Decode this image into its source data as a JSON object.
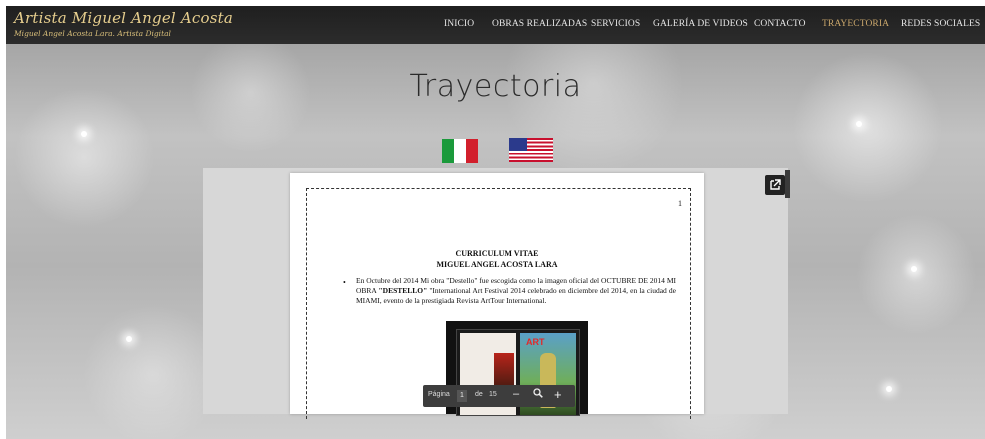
{
  "brand": {
    "title": "Artista Miguel Angel Acosta",
    "subtitle": "Miguel Angel Acosta Lara. Artista Digital"
  },
  "nav": {
    "items": [
      {
        "label": "INICIO"
      },
      {
        "label": "OBRAS REALIZADAS"
      },
      {
        "label": "SERVICIOS"
      },
      {
        "label": "GALERÍA DE VIDEOS"
      },
      {
        "label": "CONTACTO"
      },
      {
        "label": "TRAYECTORIA",
        "active": true
      },
      {
        "label": "REDES SOCIALES"
      }
    ],
    "active_color": "#c9a66b"
  },
  "page": {
    "title": "Trayectoria"
  },
  "flags": {
    "italy_icon": "italy-flag-icon",
    "usa_icon": "usa-flag-icon"
  },
  "document": {
    "page_number": "1",
    "cv_title": "CURRICULUM VITAE",
    "cv_name": "MIGUEL ANGEL ACOSTA LARA",
    "paragraph_part1": "En Octubre del 2014 Mi obra \"Destello\" fue escogida como la imagen oficial del OCTUBRE DE 2014 MI OBRA ",
    "paragraph_bold": "\"DESTELLO\"",
    "paragraph_part2": " \"International Art Festival 2014 celebrado en diciembre del 2014, en la ciudad de MIAMI, evento de la prestigiada Revista ArtTour International.",
    "magazine_badge": "ART"
  },
  "viewer_toolbar": {
    "page_label": "Página",
    "current_page": "1",
    "of_label": "de",
    "total_pages": "15"
  },
  "icons": {
    "popout": "open-in-new-icon",
    "zoom": "zoom-icon"
  }
}
